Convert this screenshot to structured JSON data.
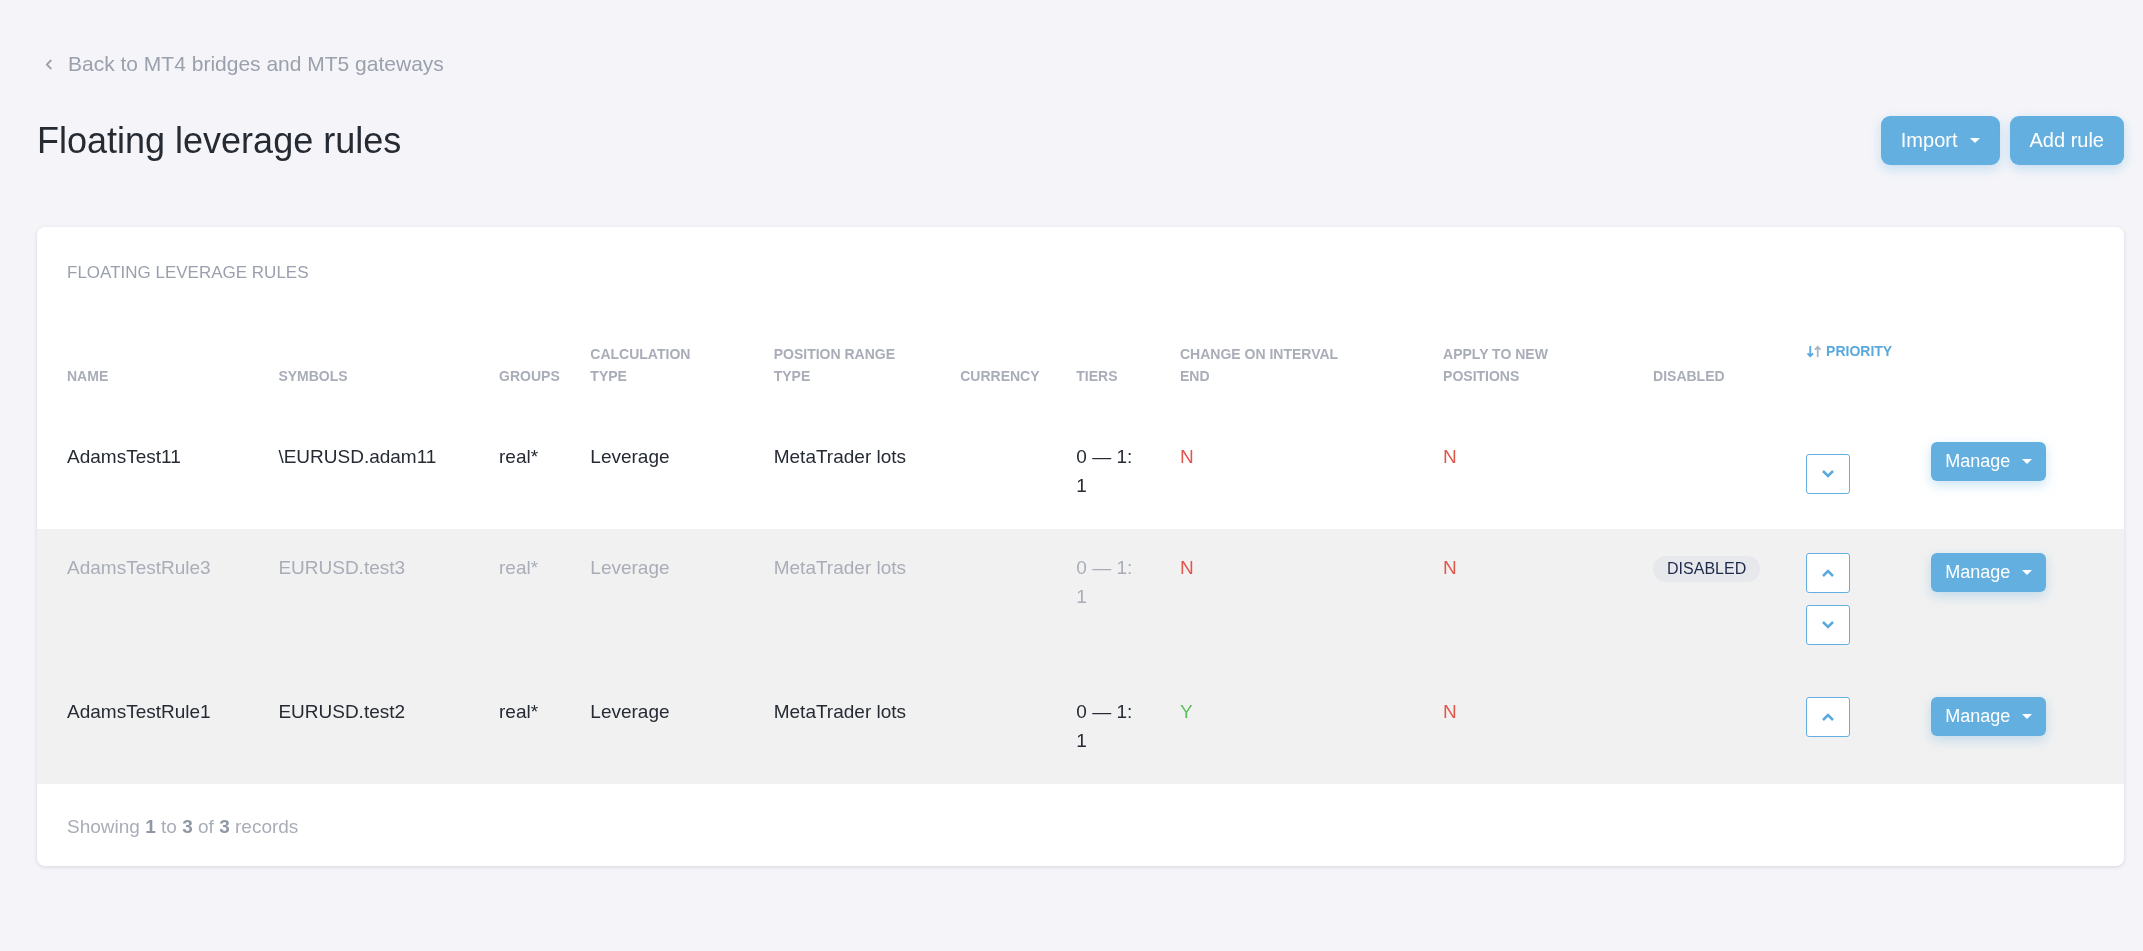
{
  "back_link": "Back to MT4 bridges and MT5 gateways",
  "page_title": "Floating leverage rules",
  "header_buttons": [
    {
      "label": "Import",
      "dropdown": true
    },
    {
      "label": "Add rule",
      "dropdown": false
    }
  ],
  "card": {
    "title": "FLOATING LEVERAGE RULES",
    "table": {
      "columns": [
        {
          "label": "NAME",
          "sortable": false
        },
        {
          "label": "SYMBOLS",
          "sortable": false
        },
        {
          "label": "GROUPS",
          "sortable": false
        },
        {
          "label": "CALCULATION TYPE",
          "sortable": false
        },
        {
          "label": "POSITION RANGE TYPE",
          "sortable": false
        },
        {
          "label": "CURRENCY",
          "sortable": false
        },
        {
          "label": "TIERS",
          "sortable": false
        },
        {
          "label": "CHANGE ON INTERVAL END",
          "sortable": false
        },
        {
          "label": "APPLY TO NEW POSITIONS",
          "sortable": false
        },
        {
          "label": "DISABLED",
          "sortable": false
        },
        {
          "label": "PRIORITY",
          "sortable": true
        }
      ],
      "rows": [
        {
          "name": "AdamsTest11",
          "symbols": "\\EURUSD.adam11",
          "groups": "real*",
          "calculation_type": "Leverage",
          "position_range_type": "MetaTrader lots",
          "tiers": "0 — 1: 1",
          "change_on_interval_end": {
            "value": "N",
            "color": "#e0584c"
          },
          "apply_to_new_positions": {
            "value": "N",
            "color": "#e0584c"
          },
          "disabled": false,
          "highlighted": false,
          "can_move_up": false,
          "can_move_down": true,
          "action": "Manage"
        },
        {
          "name": "AdamsTestRule3",
          "symbols": "EURUSD.test3",
          "groups": "real*",
          "calculation_type": "Leverage",
          "position_range_type": "MetaTrader lots",
          "tiers": "0 — 1: 1",
          "change_on_interval_end": {
            "value": "N",
            "color": "#e0584c"
          },
          "apply_to_new_positions": {
            "value": "N",
            "color": "#e0584c"
          },
          "disabled": true,
          "disabled_badge": "DISABLED",
          "highlighted": true,
          "can_move_up": true,
          "can_move_down": true,
          "action": "Manage"
        },
        {
          "name": "AdamsTestRule1",
          "symbols": "EURUSD.test2",
          "groups": "real*",
          "calculation_type": "Leverage",
          "position_range_type": "MetaTrader lots",
          "tiers": "0 — 1: 1",
          "change_on_interval_end": {
            "value": "Y",
            "color": "#5cc05a"
          },
          "apply_to_new_positions": {
            "value": "N",
            "color": "#e0584c"
          },
          "disabled": false,
          "highlighted": true,
          "can_move_up": true,
          "can_move_down": false,
          "action": "Manage"
        }
      ]
    },
    "footer": "Showing **1** to **3** of **3** records"
  }
}
